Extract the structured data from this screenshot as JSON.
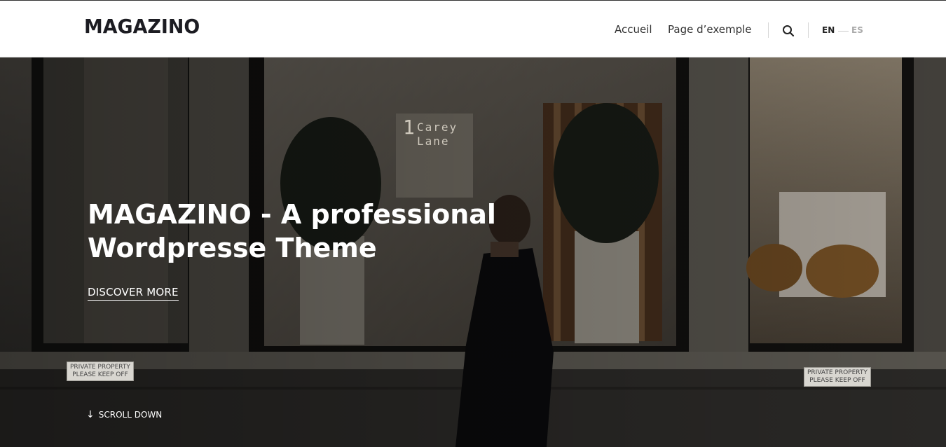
{
  "header": {
    "logo": "MAGAZINO",
    "nav": [
      "Accueil",
      "Page d’exemple"
    ],
    "languages": {
      "active": "EN",
      "inactive": "ES"
    }
  },
  "hero": {
    "title_line1": "MAGAZINO - A professional",
    "title_line2": "Wordpresse Theme",
    "cta": "DISCOVER MORE",
    "scroll": "SCROLL DOWN",
    "scroll_icon": "arrow-down-icon",
    "building_sign_line1": "Carey",
    "building_sign_line2": "Lane",
    "building_sign_number": "1",
    "private_sign_line1": "PRIVATE PROPERTY",
    "private_sign_line2": "PLEASE KEEP OFF"
  },
  "colors": {
    "overlay": "#000000",
    "text_dark": "#1c1c22",
    "inactive_lang": "#aaaaaa"
  }
}
